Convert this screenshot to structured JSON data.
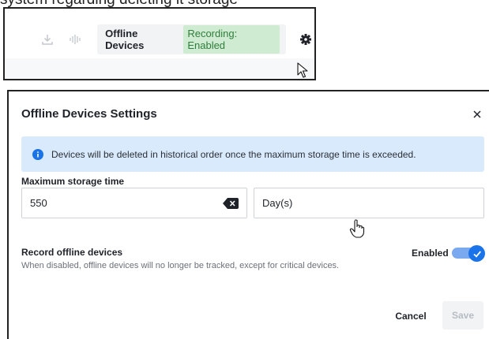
{
  "page": {
    "top_fragment": "system regarding deleting it storage"
  },
  "toolbar": {
    "status_title": "Offline Devices",
    "status_badge": "Recording: Enabled",
    "icons": [
      "download-icon",
      "waveform-icon",
      "gear-icon"
    ]
  },
  "dialog": {
    "title": "Offline Devices Settings",
    "info_text": "Devices will be deleted in historical order once the maximum storage time is exceeded.",
    "storage_label": "Maximum storage time",
    "storage_value": "550",
    "storage_unit": "Day(s)",
    "record_title": "Record offline devices",
    "record_description": "When disabled, offline devices will no longer be tracked, except for critical devices.",
    "toggle_state_label": "Enabled",
    "toggle_on": true,
    "cancel_label": "Cancel",
    "save_label": "Save"
  },
  "colors": {
    "badge_bg": "#cfecd2",
    "badge_text": "#2f7d3c",
    "info_bg": "#d8eafc",
    "accent": "#1a73e8"
  }
}
